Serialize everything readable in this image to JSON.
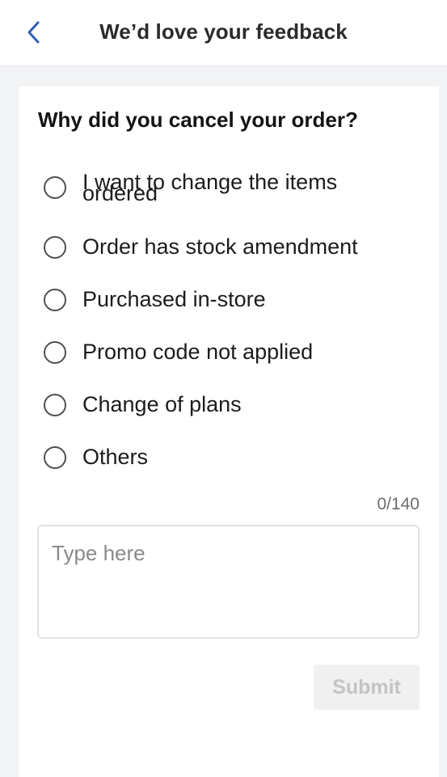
{
  "header": {
    "title": "We’d love your feedback",
    "back_icon": "chevron-left-icon",
    "accent_color": "#2f5fb3"
  },
  "form": {
    "question": "Why did you cancel your order?",
    "options": [
      {
        "label": "I want to change the items ordered",
        "selected": false
      },
      {
        "label": "Order has stock amendment",
        "selected": false
      },
      {
        "label": "Purchased in-store",
        "selected": false
      },
      {
        "label": "Promo code not applied",
        "selected": false
      },
      {
        "label": "Change of plans",
        "selected": false
      },
      {
        "label": "Others",
        "selected": false
      }
    ],
    "char_counter": "0/140",
    "textarea_placeholder": "Type here",
    "submit_label": "Submit"
  }
}
